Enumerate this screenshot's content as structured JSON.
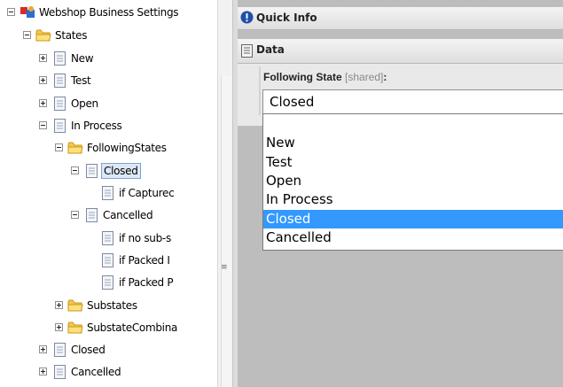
{
  "tree": {
    "nodes": [
      {
        "label": "Webshop Business Settings",
        "icon": "settings-root-icon",
        "toggle": "minus",
        "indent": 0
      },
      {
        "label": "States",
        "icon": "folder-icon",
        "toggle": "minus",
        "indent": 1
      },
      {
        "label": "New",
        "icon": "document-icon",
        "toggle": "plus",
        "indent": 2
      },
      {
        "label": "Test",
        "icon": "document-icon",
        "toggle": "plus",
        "indent": 2
      },
      {
        "label": "Open",
        "icon": "document-icon",
        "toggle": "plus",
        "indent": 2
      },
      {
        "label": "In Process",
        "icon": "document-icon",
        "toggle": "minus",
        "indent": 2
      },
      {
        "label": "FollowingStates",
        "icon": "folder-icon",
        "toggle": "minus",
        "indent": 3
      },
      {
        "label": "Closed",
        "icon": "document-icon",
        "toggle": "minus",
        "indent": 4,
        "selected": true
      },
      {
        "label": "if Capturec",
        "icon": "document-icon",
        "toggle": "",
        "indent": 5
      },
      {
        "label": "Cancelled",
        "icon": "document-icon",
        "toggle": "minus",
        "indent": 4
      },
      {
        "label": "if no sub-s",
        "icon": "document-icon",
        "toggle": "",
        "indent": 5
      },
      {
        "label": "if Packed I",
        "icon": "document-icon",
        "toggle": "",
        "indent": 5
      },
      {
        "label": "if Packed P",
        "icon": "document-icon",
        "toggle": "",
        "indent": 5
      },
      {
        "label": "Substates",
        "icon": "folder-icon",
        "toggle": "plus",
        "indent": 3
      },
      {
        "label": "SubstateCombina",
        "icon": "folder-icon",
        "toggle": "plus",
        "indent": 3
      },
      {
        "label": "Closed",
        "icon": "document-icon",
        "toggle": "plus",
        "indent": 2
      },
      {
        "label": "Cancelled",
        "icon": "document-icon",
        "toggle": "plus",
        "indent": 2
      }
    ]
  },
  "panel": {
    "quick_info_title": "Quick Info",
    "data_title": "Data"
  },
  "field": {
    "label": "Following State",
    "shared_tag": "[shared]",
    "colon": ":",
    "value": "Closed"
  },
  "dropdown": {
    "options": [
      "",
      "New",
      "Test",
      "Open",
      "In Process",
      "Closed",
      "Cancelled"
    ],
    "selected_index": 5
  },
  "colors": {
    "selection": "#3399ff",
    "tree_selection": "#dce8f5"
  }
}
